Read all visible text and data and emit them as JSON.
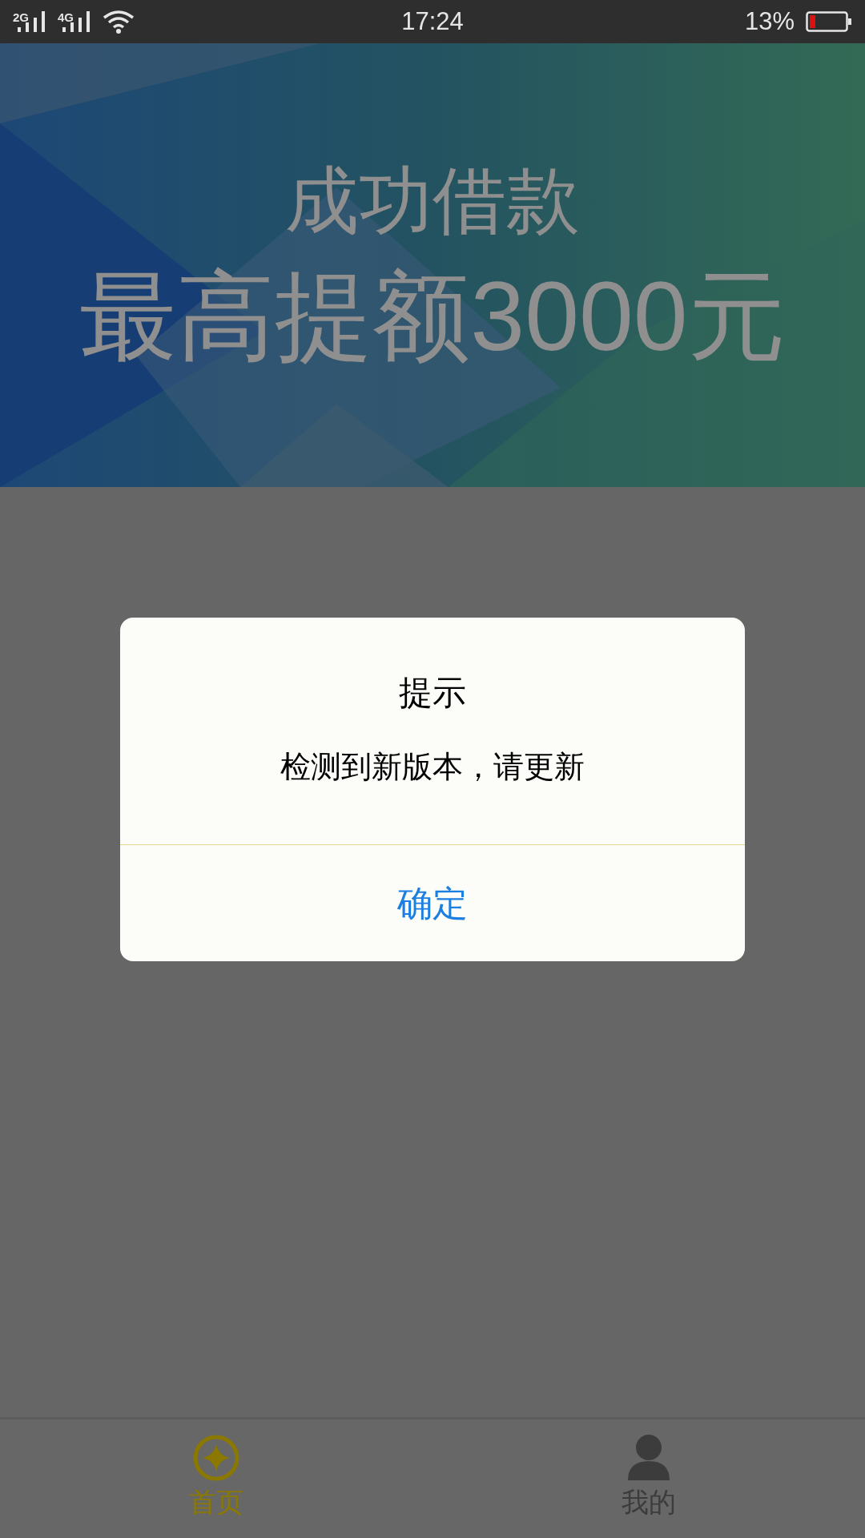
{
  "status_bar": {
    "networks": [
      "2G",
      "4G"
    ],
    "time": "17:24",
    "battery": "13%"
  },
  "banner": {
    "kind": "picture",
    "headline": "成功借款",
    "subline": "最高提额3000元"
  },
  "dialog": {
    "title": "提示",
    "message": "检测到新版本，请更新",
    "button": "确定"
  },
  "tabs": [
    {
      "label": "首页",
      "selected": true
    },
    {
      "label": "我的",
      "selected": false
    }
  ]
}
